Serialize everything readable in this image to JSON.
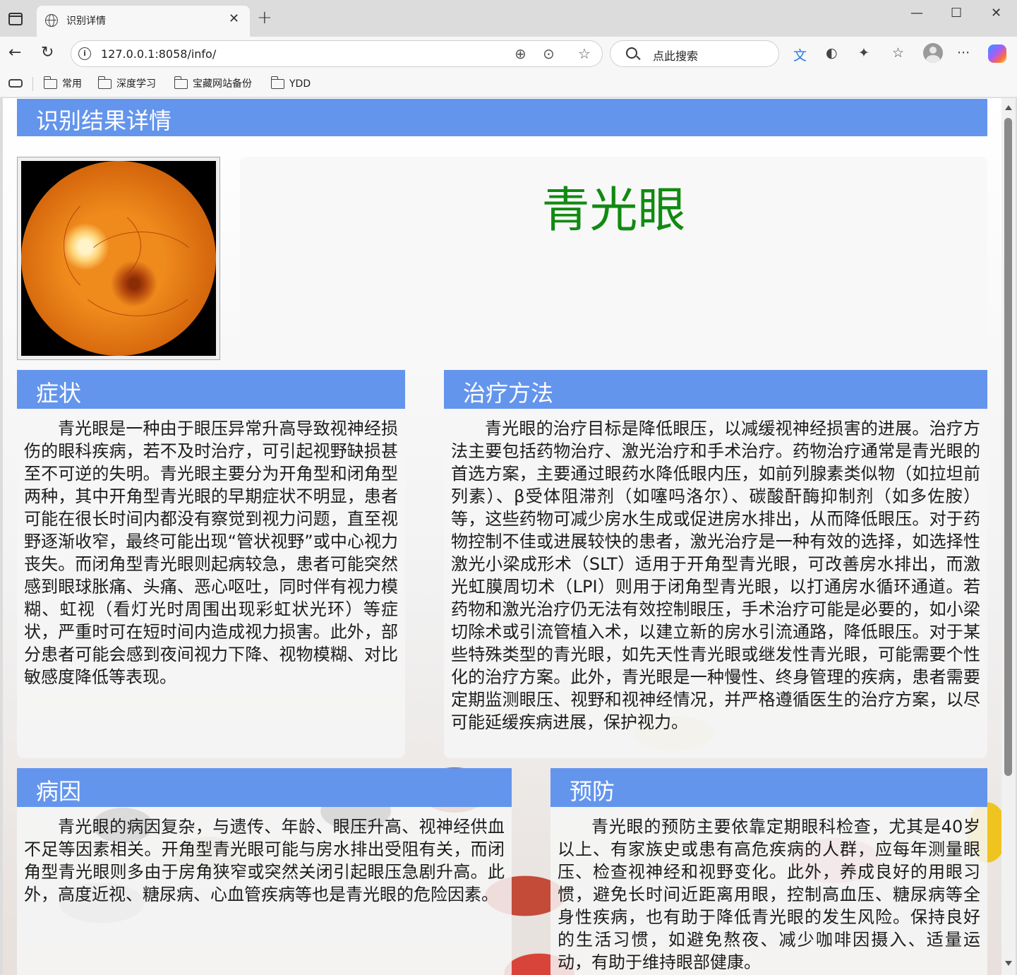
{
  "browser": {
    "tab_title": "识别详情",
    "url": "127.0.0.1:8058/info/",
    "search_placeholder": "点此搜索",
    "bookmarks": [
      "常用",
      "深度学习",
      "宝藏网站备份",
      "YDD"
    ]
  },
  "page": {
    "header_title": "识别结果详情",
    "result_name": "青光眼",
    "result_color": "#118a11",
    "accent_color": "#6495ed"
  },
  "sections": {
    "symptoms": {
      "title": "症状",
      "text": "青光眼是一种由于眼压异常升高导致视神经损伤的眼科疾病，若不及时治疗，可引起视野缺损甚至不可逆的失明。青光眼主要分为开角型和闭角型两种，其中开角型青光眼的早期症状不明显，患者可能在很长时间内都没有察觉到视力问题，直至视野逐渐收窄，最终可能出现“管状视野”或中心视力丧失。而闭角型青光眼则起病较急，患者可能突然感到眼球胀痛、头痛、恶心呕吐，同时伴有视力模糊、虹视（看灯光时周围出现彩虹状光环）等症状，严重时可在短时间内造成视力损害。此外，部分患者可能会感到夜间视力下降、视物模糊、对比敏感度降低等表现。"
    },
    "treatment": {
      "title": "治疗方法",
      "text": "青光眼的治疗目标是降低眼压，以减缓视神经损害的进展。治疗方法主要包括药物治疗、激光治疗和手术治疗。药物治疗通常是青光眼的首选方案，主要通过眼药水降低眼内压，如前列腺素类似物（如拉坦前列素）、β受体阻滞剂（如噻吗洛尔）、碳酸酐酶抑制剂（如多佐胺）等，这些药物可减少房水生成或促进房水排出，从而降低眼压。对于药物控制不佳或进展较快的患者，激光治疗是一种有效的选择，如选择性激光小梁成形术（SLT）适用于开角型青光眼，可改善房水排出，而激光虹膜周切术（LPI）则用于闭角型青光眼，以打通房水循环通道。若药物和激光治疗仍无法有效控制眼压，手术治疗可能是必要的，如小梁切除术或引流管植入术，以建立新的房水引流通路，降低眼压。对于某些特殊类型的青光眼，如先天性青光眼或继发性青光眼，可能需要个性化的治疗方案。此外，青光眼是一种慢性、终身管理的疾病，患者需要定期监测眼压、视野和视神经情况，并严格遵循医生的治疗方案，以尽可能延缓疾病进展，保护视力。"
    },
    "cause": {
      "title": "病因",
      "text": "青光眼的病因复杂，与遗传、年龄、眼压升高、视神经供血不足等因素相关。开角型青光眼可能与房水排出受阻有关，而闭角型青光眼则多由于房角狭窄或突然关闭引起眼压急剧升高。此外，高度近视、糖尿病、心血管疾病等也是青光眼的危险因素。"
    },
    "prevention": {
      "title": "预防",
      "text": "青光眼的预防主要依靠定期眼科检查，尤其是40岁以上、有家族史或患有高危疾病的人群，应每年测量眼压、检查视神经和视野变化。此外，养成良好的用眼习惯，避免长时间近距离用眼，控制高血压、糖尿病等全身性疾病，也有助于降低青光眼的发生风险。保持良好的生活习惯，如避免熬夜、减少咖啡因摄入、适量运动，有助于维持眼部健康。"
    }
  }
}
